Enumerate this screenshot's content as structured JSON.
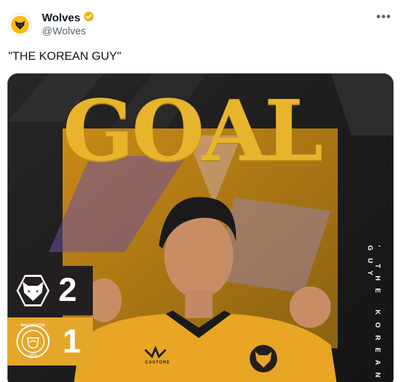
{
  "tweet": {
    "display_name": "Wolves",
    "handle": "@Wolves",
    "verified": true,
    "text": "\"THE KOREAN GUY\"",
    "more_label": "•••"
  },
  "media": {
    "headline": "GOAL",
    "side_text": "' THE KOREAN GUY",
    "score": {
      "home_score": "2",
      "away_score": "1",
      "home_crest_icon": "wolves-crest-icon",
      "away_crest_icon": "manchester-city-crest-icon",
      "away_crest_text_top": "MANCHESTER",
      "away_crest_text_bottom": "CITY"
    },
    "sponsor": "CASTORE",
    "colors": {
      "gold": "#e7b42b",
      "dark": "#231f20",
      "shirt": "#e9a524"
    }
  }
}
